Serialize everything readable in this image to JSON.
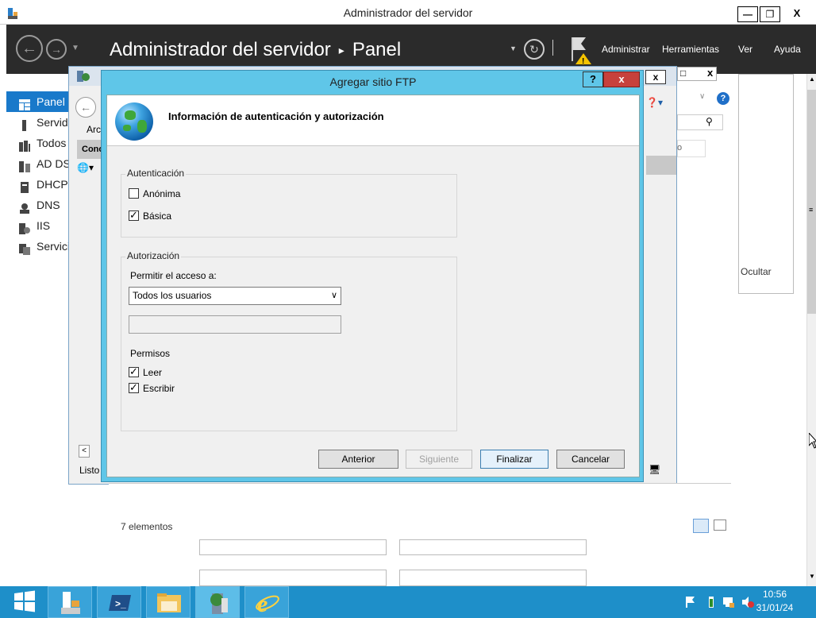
{
  "server_manager": {
    "window_title": "Administrador del servidor",
    "breadcrumb_root": "Administrador del servidor",
    "breadcrumb_sep": "▸",
    "breadcrumb_page": "Panel",
    "menu": [
      "Administrar",
      "Herramientas",
      "Ver",
      "Ayuda"
    ],
    "nav_items": [
      "Panel",
      "Servid",
      "Todos",
      "AD DS",
      "DHCP",
      "DNS",
      "IIS",
      "Servici"
    ],
    "hide_label": "Ocultar"
  },
  "iis_manager": {
    "menu_partial": "Arc",
    "connections_partial": "Conc",
    "status": "Listo"
  },
  "explorer": {
    "status_count": "7 elementos",
    "search_partial": "o"
  },
  "dialog": {
    "title": "Agregar sitio FTP",
    "help": "?",
    "close": "x",
    "heading": "Información de autenticación y autorización",
    "auth_group": "Autenticación",
    "anon_label": "Anónima",
    "anon_checked": false,
    "basic_label": "Básica",
    "basic_checked": true,
    "authz_group": "Autorización",
    "access_label": "Permitir el acceso a:",
    "access_value": "Todos los usuarios",
    "perms_label": "Permisos",
    "read_label": "Leer",
    "read_checked": true,
    "write_label": "Escribir",
    "write_checked": true,
    "btn_prev": "Anterior",
    "btn_next": "Siguiente",
    "btn_finish": "Finalizar",
    "btn_cancel": "Cancelar"
  },
  "taskbar": {
    "time": "10:56",
    "date": "31/01/24"
  }
}
